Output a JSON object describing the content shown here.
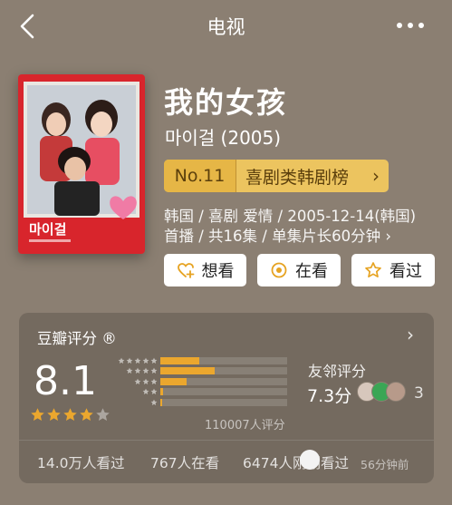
{
  "nav": {
    "title": "电视",
    "back_icon": "chevron-left-icon",
    "more_icon": "more-dots-icon"
  },
  "poster": {
    "logo_text": "마이걸"
  },
  "movie": {
    "title": "我的女孩",
    "original_title_year": "마이걸 (2005)",
    "rank_no": "No.11",
    "rank_label": "喜剧类韩剧榜",
    "meta_line1": "韩国 / 喜剧 爱情 / 2005-12-14(韩国)",
    "meta_line2": "首播 / 共16集 / 单集片长60分钟 ›"
  },
  "actions": {
    "want": "想看",
    "doing": "在看",
    "done": "看过"
  },
  "rating": {
    "title": "豆瓣评分 ®",
    "score": "8.1",
    "star_value": 4,
    "star_max": 5,
    "distribution": [
      0.31,
      0.43,
      0.21,
      0.02,
      0.01
    ],
    "count_text": "110007人评分",
    "friend_title": "友邻评分",
    "friend_score": "7.3分",
    "friend_count": "3"
  },
  "stats": {
    "watched": "14.0万人看过",
    "watching": "767人在看",
    "recent": "6474人刚刚看过",
    "updated": "56分钟前"
  },
  "colors": {
    "background": "#8b7f72",
    "accent_star": "#eba72e",
    "rank_pill": "#ecc45f"
  }
}
